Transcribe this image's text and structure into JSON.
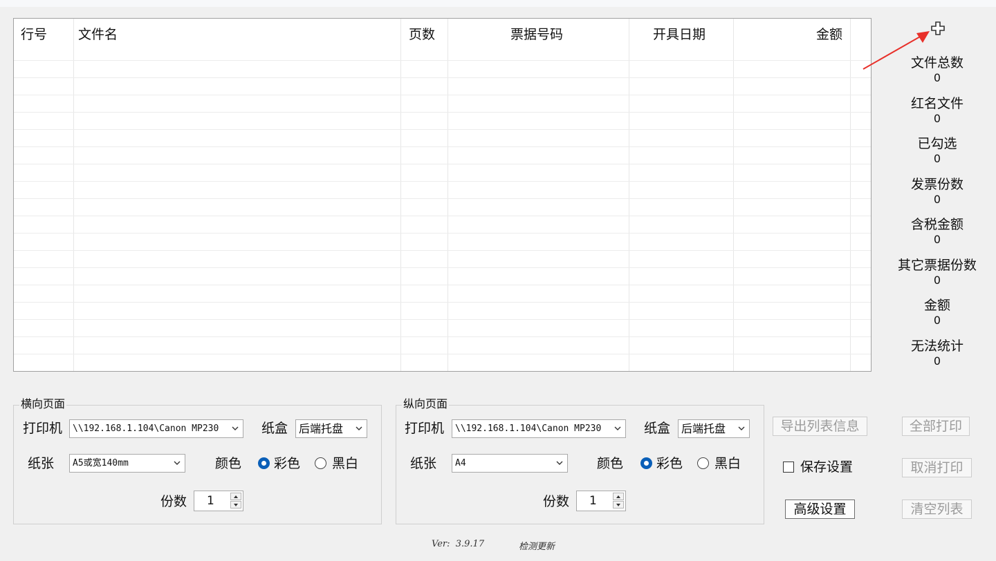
{
  "table": {
    "columns": [
      "行号",
      "文件名",
      "页数",
      "票据号码",
      "开具日期",
      "金额"
    ],
    "rows": []
  },
  "stats": [
    {
      "label": "文件总数",
      "value": "0"
    },
    {
      "label": "红名文件",
      "value": "0"
    },
    {
      "label": "已勾选",
      "value": "0"
    },
    {
      "label": "发票份数",
      "value": "0"
    },
    {
      "label": "含税金额",
      "value": "0"
    },
    {
      "label": "其它票据份数",
      "value": "0"
    },
    {
      "label": "金额",
      "value": "0"
    },
    {
      "label": "无法统计",
      "value": "0"
    }
  ],
  "landscape": {
    "title": "横向页面",
    "printer_label": "打印机",
    "printer_value": "\\\\192.168.1.104\\Canon MP230",
    "tray_label": "纸盒",
    "tray_value": "后端托盘",
    "paper_label": "纸张",
    "paper_value": "A5或宽140mm",
    "color_label": "颜色",
    "color_option": "彩色",
    "bw_option": "黑白",
    "color_selected": "彩色",
    "copies_label": "份数",
    "copies_value": "1"
  },
  "portrait": {
    "title": "纵向页面",
    "printer_label": "打印机",
    "printer_value": "\\\\192.168.1.104\\Canon MP230",
    "tray_label": "纸盒",
    "tray_value": "后端托盘",
    "paper_label": "纸张",
    "paper_value": "A4",
    "color_label": "颜色",
    "color_option": "彩色",
    "bw_option": "黑白",
    "color_selected": "彩色",
    "copies_label": "份数",
    "copies_value": "1"
  },
  "buttons": {
    "export": "导出列表信息",
    "print_all": "全部打印",
    "save_settings": "保存设置",
    "cancel_print": "取消打印",
    "advanced": "高级设置",
    "clear_list": "清空列表"
  },
  "footer": {
    "version": "Ver:  3.9.17",
    "check_update": "检测更新"
  },
  "colors": {
    "radio_selected": "#0a5fb8",
    "arrow": "#e8302a"
  }
}
